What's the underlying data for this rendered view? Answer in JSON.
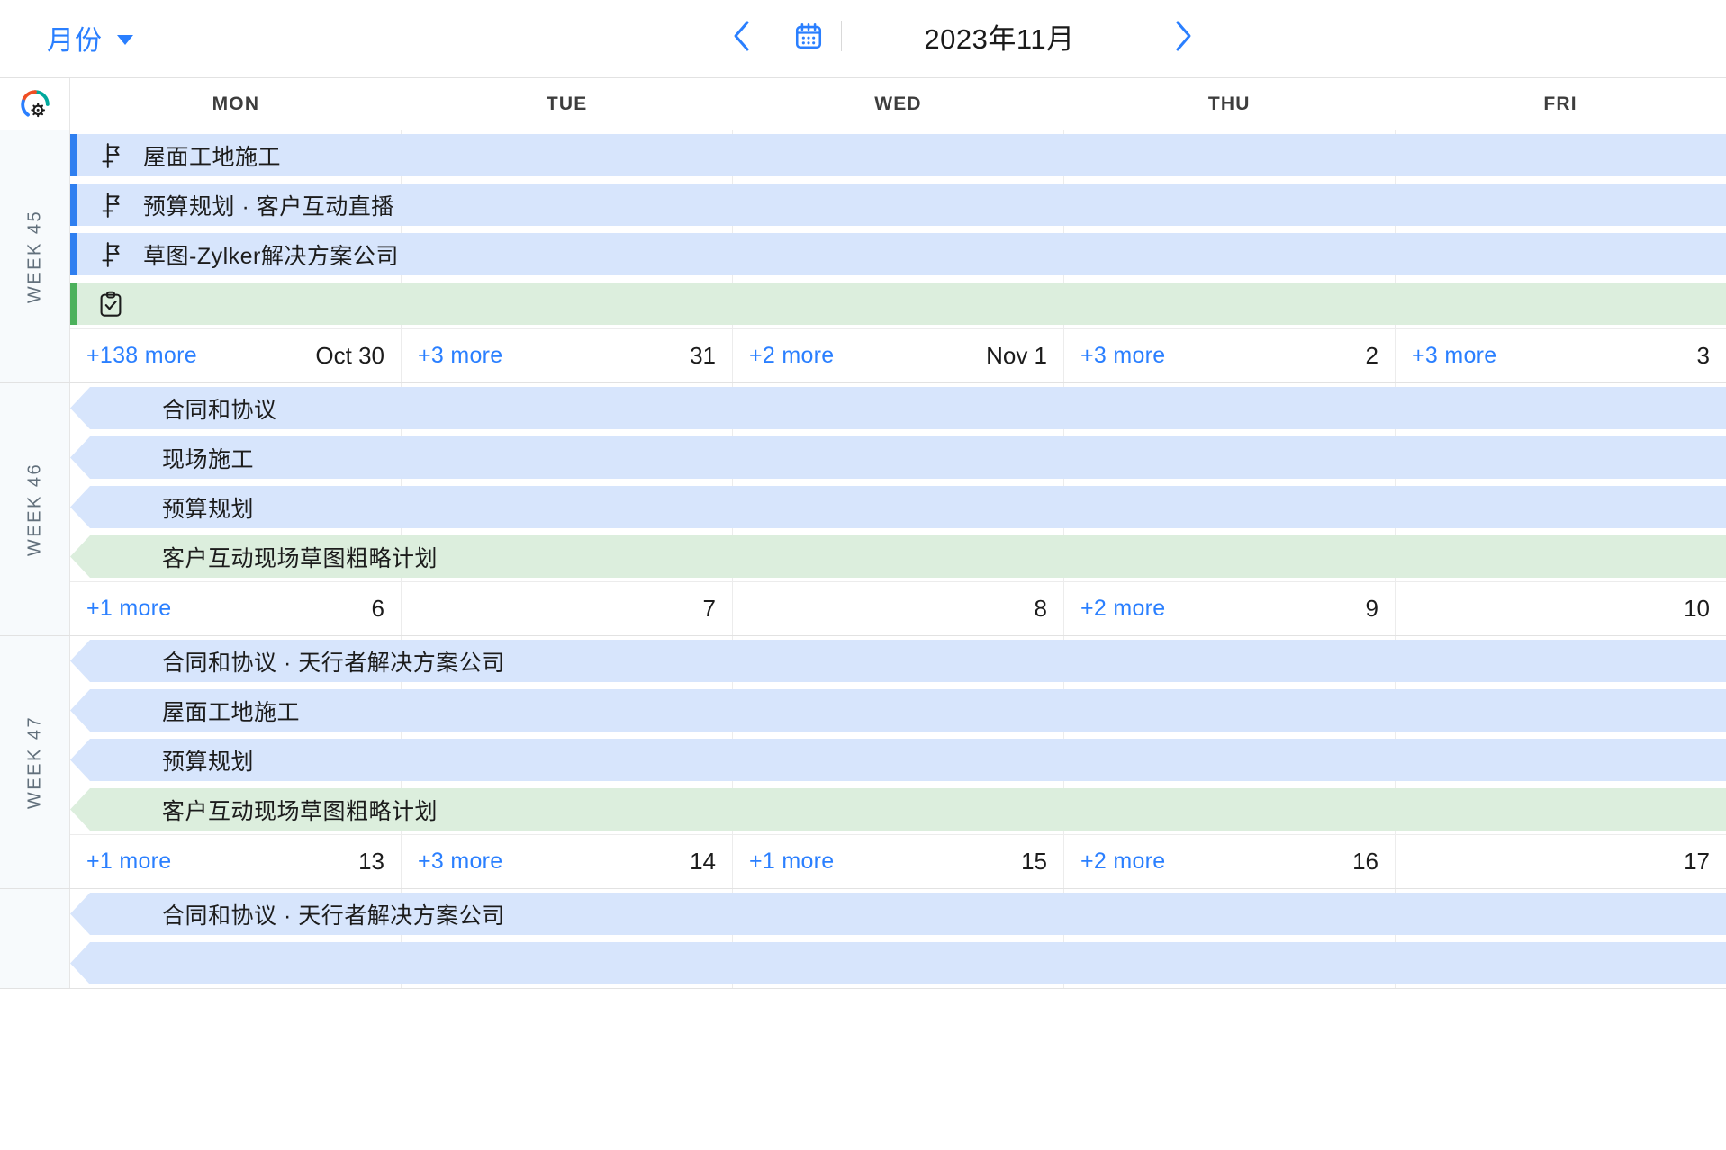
{
  "toolbar": {
    "view_label": "月份",
    "view_caret_icon": "chevron-down-icon",
    "prev_icon": "chevron-left-icon",
    "next_icon": "chevron-right-icon",
    "today_icon": "calendar-icon",
    "date_title": "2023年11月"
  },
  "grid": {
    "settings_icon": "zoho-gear-icon",
    "weekdays": [
      "MON",
      "TUE",
      "WED",
      "THU",
      "FRI"
    ]
  },
  "colors": {
    "accent_blue": "#2a7fff",
    "event_blue_bg": "#d7e5fc",
    "event_blue_bar": "#2f7ff0",
    "event_green_bg": "#dceedd",
    "event_green_bar": "#4cb15c",
    "text_primary": "#1c1c1c",
    "week_label": "#62707c"
  },
  "weeks": [
    {
      "label": "WEEK 45",
      "events": [
        {
          "title": "屋面工地施工",
          "color": "blue",
          "style": "start",
          "icon": "milestone-icon",
          "start_col": 0,
          "span": 5
        },
        {
          "title": "预算规划 · 客户互动直播",
          "color": "blue",
          "style": "start",
          "icon": "milestone-icon",
          "start_col": 0,
          "span": 5
        },
        {
          "title": "草图-Zylker解决方案公司",
          "color": "blue",
          "style": "start",
          "icon": "milestone-icon",
          "start_col": 0,
          "span": 5
        },
        {
          "title": "",
          "color": "green",
          "style": "start",
          "icon": "task-clipboard-icon",
          "start_col": 0,
          "span": 5
        }
      ],
      "days": [
        {
          "more": "+138 more",
          "label": "Oct 30"
        },
        {
          "more": "+3 more",
          "label": "31"
        },
        {
          "more": "+2 more",
          "label": "Nov 1"
        },
        {
          "more": "+3 more",
          "label": "2"
        },
        {
          "more": "+3 more",
          "label": "3"
        }
      ]
    },
    {
      "label": "WEEK 46",
      "events": [
        {
          "title": "合同和协议",
          "color": "blue",
          "style": "cont",
          "icon": "",
          "start_col": 0,
          "span": 5
        },
        {
          "title": "现场施工",
          "color": "blue",
          "style": "cont",
          "icon": "",
          "start_col": 0,
          "span": 5
        },
        {
          "title": "预算规划",
          "color": "blue",
          "style": "cont",
          "icon": "",
          "start_col": 0,
          "span": 5
        },
        {
          "title": "客户互动现场草图粗略计划",
          "color": "green",
          "style": "cont",
          "icon": "",
          "start_col": 0,
          "span": 5
        }
      ],
      "days": [
        {
          "more": "+1 more",
          "label": "6"
        },
        {
          "more": "",
          "label": "7"
        },
        {
          "more": "",
          "label": "8"
        },
        {
          "more": "+2 more",
          "label": "9"
        },
        {
          "more": "",
          "label": "10"
        }
      ]
    },
    {
      "label": "WEEK 47",
      "events": [
        {
          "title": "合同和协议 · 天行者解决方案公司",
          "color": "blue",
          "style": "cont",
          "icon": "",
          "start_col": 0,
          "span": 5
        },
        {
          "title": "屋面工地施工",
          "color": "blue",
          "style": "cont",
          "icon": "",
          "start_col": 0,
          "span": 5
        },
        {
          "title": "预算规划",
          "color": "blue",
          "style": "cont",
          "icon": "",
          "start_col": 0,
          "span": 5
        },
        {
          "title": "客户互动现场草图粗略计划",
          "color": "green",
          "style": "cont",
          "icon": "",
          "start_col": 0,
          "span": 5
        }
      ],
      "days": [
        {
          "more": "+1 more",
          "label": "13"
        },
        {
          "more": "+3 more",
          "label": "14"
        },
        {
          "more": "+1 more",
          "label": "15"
        },
        {
          "more": "+2 more",
          "label": "16"
        },
        {
          "more": "",
          "label": "17"
        }
      ]
    },
    {
      "label": "",
      "events": [
        {
          "title": "合同和协议 · 天行者解决方案公司",
          "color": "blue",
          "style": "cont",
          "icon": "",
          "start_col": 0,
          "span": 5
        },
        {
          "title": "",
          "color": "blue",
          "style": "cont",
          "icon": "",
          "start_col": 0,
          "span": 5
        }
      ],
      "days": []
    }
  ]
}
